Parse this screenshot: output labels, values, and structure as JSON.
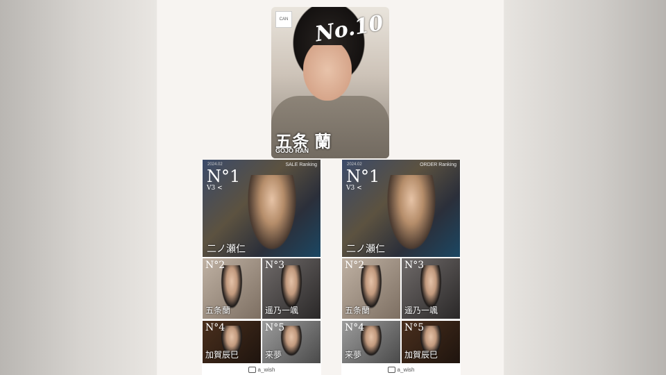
{
  "profile": {
    "badge": "CAN",
    "number": "No.10",
    "name_kanji": "五条 蘭",
    "name_roman": "GOJO RAN"
  },
  "posters": [
    {
      "date": "2024.02",
      "title": "SALE Ranking",
      "rank1_no": "N°1",
      "rank1_sub": "V3 <",
      "rank1_name": "二ノ瀬仁",
      "ranks": [
        {
          "no": "N°2",
          "name": "五条蘭"
        },
        {
          "no": "N°3",
          "name": "遥乃一颯"
        },
        {
          "no": "N°4",
          "name": "加賀辰巳"
        },
        {
          "no": "N°5",
          "name": "来夢"
        }
      ],
      "footer": "a_wish"
    },
    {
      "date": "2024.02",
      "title": "ORDER Ranking",
      "rank1_no": "N°1",
      "rank1_sub": "V3 <",
      "rank1_name": "二ノ瀬仁",
      "ranks": [
        {
          "no": "N°2",
          "name": "五条蘭"
        },
        {
          "no": "N°3",
          "name": "遥乃一颯"
        },
        {
          "no": "N°4",
          "name": "来夢"
        },
        {
          "no": "N°5",
          "name": "加賀辰巳"
        }
      ],
      "footer": "a_wish"
    }
  ]
}
